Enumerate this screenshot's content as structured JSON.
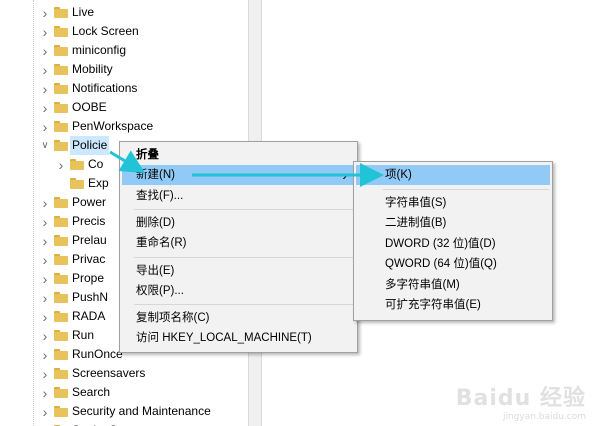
{
  "tree": {
    "items": [
      {
        "label": "Live",
        "expanded": false
      },
      {
        "label": "Lock Screen",
        "expanded": false
      },
      {
        "label": "miniconfig",
        "expanded": false
      },
      {
        "label": "Mobility",
        "expanded": false
      },
      {
        "label": "Notifications",
        "expanded": false
      },
      {
        "label": "OOBE",
        "expanded": false
      },
      {
        "label": "PenWorkspace",
        "expanded": false
      },
      {
        "label": "Policie",
        "expanded": true,
        "selected": true
      },
      {
        "label": "Co",
        "expanded": false,
        "child": true
      },
      {
        "label": "Exp",
        "expanded": null,
        "child": true
      },
      {
        "label": "Power",
        "expanded": false
      },
      {
        "label": "Precis",
        "expanded": false
      },
      {
        "label": "Prelau",
        "expanded": false
      },
      {
        "label": "Privac",
        "expanded": false
      },
      {
        "label": "Prope",
        "expanded": false
      },
      {
        "label": "PushN",
        "expanded": false
      },
      {
        "label": "RADA",
        "expanded": false
      },
      {
        "label": "Run",
        "expanded": false
      },
      {
        "label": "RunOnce",
        "expanded": false
      },
      {
        "label": "Screensavers",
        "expanded": false
      },
      {
        "label": "Search",
        "expanded": false
      },
      {
        "label": "Security and Maintenance",
        "expanded": false
      },
      {
        "label": "SettingSync",
        "expanded": false
      }
    ]
  },
  "context_menu": {
    "items": [
      {
        "label": "折叠",
        "bold": true
      },
      {
        "label": "新建(N)",
        "highlighted": true,
        "submenu": true
      },
      {
        "label": "查找(F)..."
      },
      {
        "separator": true
      },
      {
        "label": "删除(D)"
      },
      {
        "label": "重命名(R)"
      },
      {
        "separator": true
      },
      {
        "label": "导出(E)"
      },
      {
        "label": "权限(P)..."
      },
      {
        "separator": true
      },
      {
        "label": "复制项名称(C)"
      },
      {
        "label": "访问 HKEY_LOCAL_MACHINE(T)"
      }
    ]
  },
  "submenu": {
    "items": [
      {
        "label": "项(K)",
        "highlighted": true
      },
      {
        "separator": true
      },
      {
        "label": "字符串值(S)"
      },
      {
        "label": "二进制值(B)"
      },
      {
        "label": "DWORD (32 位)值(D)"
      },
      {
        "label": "QWORD (64 位)值(Q)"
      },
      {
        "label": "多字符串值(M)"
      },
      {
        "label": "可扩充字符串值(E)"
      }
    ]
  },
  "watermark": {
    "logo": "Baidu 经验",
    "url": "jingyan.baidu.com"
  },
  "colors": {
    "folder": "#e8c25b",
    "highlight": "#91c9f7",
    "arrow": "#22c3d6",
    "menu_bg": "#f2f2f2"
  }
}
